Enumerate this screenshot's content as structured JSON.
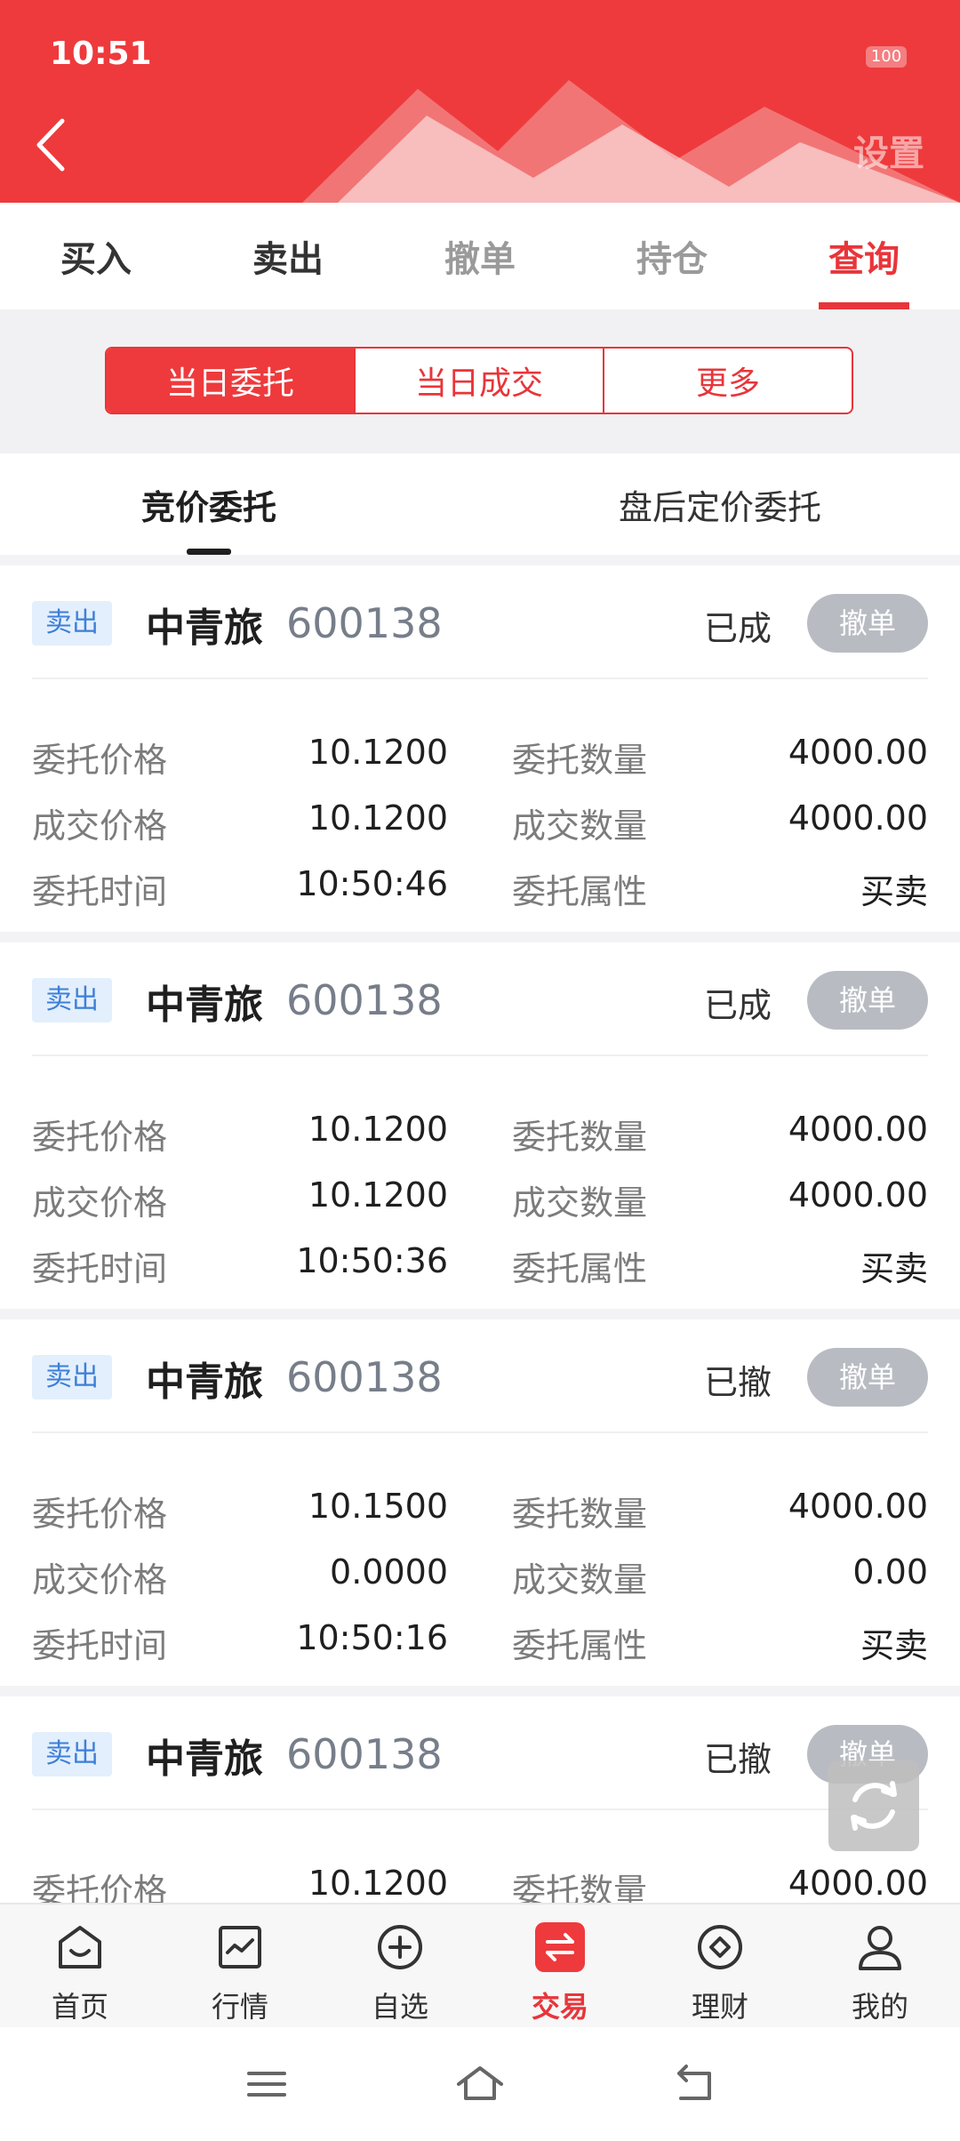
{
  "status_bar": {
    "time": "10:51",
    "battery": "100"
  },
  "header": {
    "settings_label": "设置"
  },
  "top_tabs": [
    {
      "label": "买入",
      "state": "normal"
    },
    {
      "label": "卖出",
      "state": "normal"
    },
    {
      "label": "撤单",
      "state": "faded"
    },
    {
      "label": "持仓",
      "state": "faded"
    },
    {
      "label": "查询",
      "state": "active"
    }
  ],
  "segmented": [
    {
      "label": "当日委托",
      "active": true
    },
    {
      "label": "当日成交",
      "active": false
    },
    {
      "label": "更多",
      "active": false
    }
  ],
  "sub_tabs": [
    {
      "label": "竞价委托",
      "active": true
    },
    {
      "label": "盘后定价委托",
      "active": false
    }
  ],
  "orders": [
    {
      "side": "卖出",
      "name": "中青旅",
      "code": "600138",
      "status": "已成",
      "cancel": "撤单",
      "fields": [
        {
          "label": "委托价格",
          "value": "10.1200"
        },
        {
          "label": "委托数量",
          "value": "4000.00"
        },
        {
          "label": "成交价格",
          "value": "10.1200"
        },
        {
          "label": "成交数量",
          "value": "4000.00"
        },
        {
          "label": "委托时间",
          "value": "10:50:46"
        },
        {
          "label": "委托属性",
          "value": "买卖"
        }
      ]
    },
    {
      "side": "卖出",
      "name": "中青旅",
      "code": "600138",
      "status": "已成",
      "cancel": "撤单",
      "fields": [
        {
          "label": "委托价格",
          "value": "10.1200"
        },
        {
          "label": "委托数量",
          "value": "4000.00"
        },
        {
          "label": "成交价格",
          "value": "10.1200"
        },
        {
          "label": "成交数量",
          "value": "4000.00"
        },
        {
          "label": "委托时间",
          "value": "10:50:36"
        },
        {
          "label": "委托属性",
          "value": "买卖"
        }
      ]
    },
    {
      "side": "卖出",
      "name": "中青旅",
      "code": "600138",
      "status": "已撤",
      "cancel": "撤单",
      "fields": [
        {
          "label": "委托价格",
          "value": "10.1500"
        },
        {
          "label": "委托数量",
          "value": "4000.00"
        },
        {
          "label": "成交价格",
          "value": "0.0000"
        },
        {
          "label": "成交数量",
          "value": "0.00"
        },
        {
          "label": "委托时间",
          "value": "10:50:16"
        },
        {
          "label": "委托属性",
          "value": "买卖"
        }
      ]
    },
    {
      "side": "卖出",
      "name": "中青旅",
      "code": "600138",
      "status": "已撤",
      "cancel": "撤单",
      "fields": [
        {
          "label": "委托价格",
          "value": "10.1200"
        },
        {
          "label": "委托数量",
          "value": "4000.00"
        }
      ]
    }
  ],
  "bottom_nav": [
    {
      "label": "首页",
      "icon": "home-icon",
      "active": false
    },
    {
      "label": "行情",
      "icon": "chart-icon",
      "active": false
    },
    {
      "label": "自选",
      "icon": "plus-circle-icon",
      "active": false
    },
    {
      "label": "交易",
      "icon": "exchange-icon",
      "active": true
    },
    {
      "label": "理财",
      "icon": "diamond-icon",
      "active": false
    },
    {
      "label": "我的",
      "icon": "user-icon",
      "active": false
    }
  ],
  "colors": {
    "brand": "#ee3a3c",
    "badge_bg": "#e3effc",
    "badge_text": "#3d7fd9",
    "cancel_bg": "#b8bcc2"
  }
}
